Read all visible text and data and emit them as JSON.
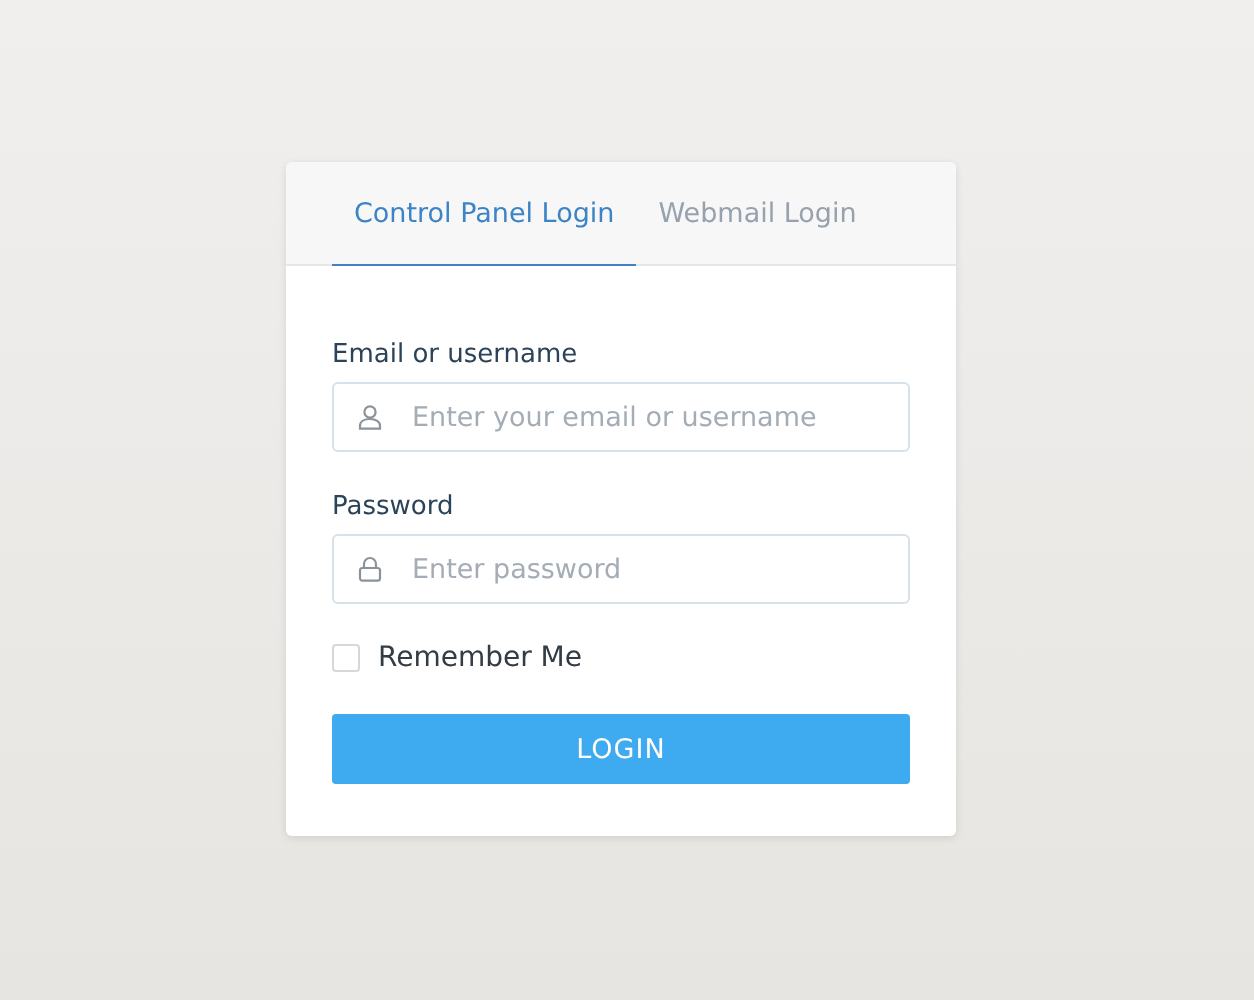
{
  "tabs": [
    {
      "label": "Control Panel Login",
      "selected": true
    },
    {
      "label": "Webmail Login",
      "selected": false
    }
  ],
  "fields": [
    {
      "kind": "user",
      "label": "Email or username",
      "placeholder": "Enter your email or username"
    },
    {
      "kind": "password",
      "label": "Password",
      "placeholder": "Enter password"
    }
  ],
  "remember": {
    "label": "Remember Me",
    "checked": false
  },
  "button": "LOGIN"
}
